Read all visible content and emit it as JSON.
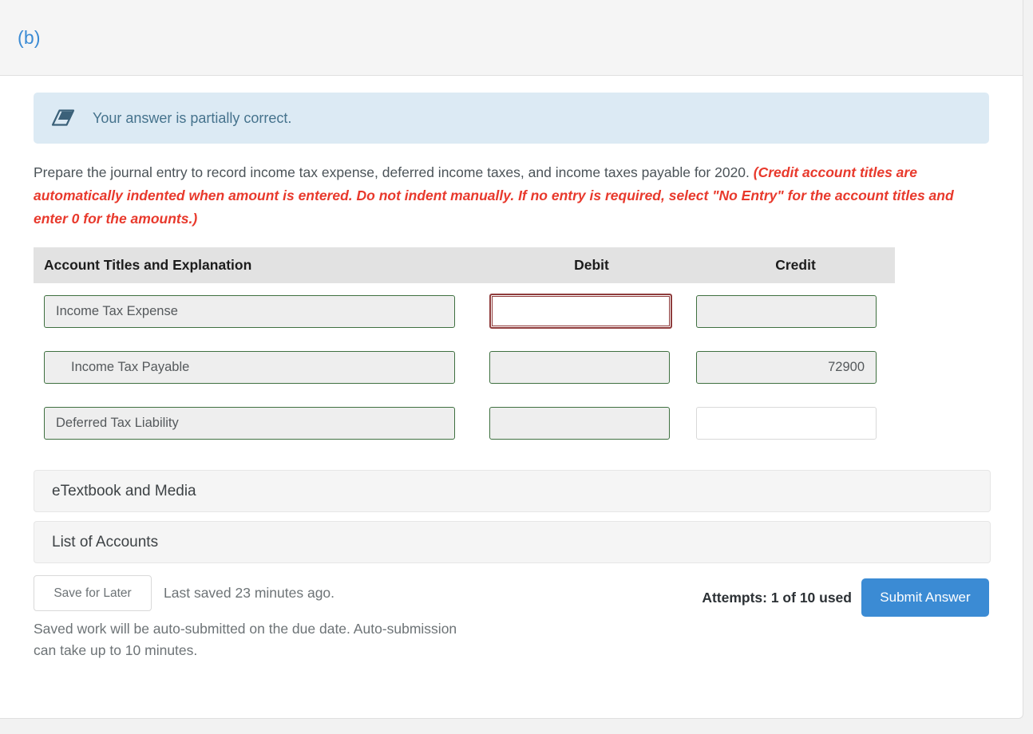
{
  "panel": {
    "part_label": "(b)"
  },
  "alert": {
    "icon": "eraser-icon",
    "message": "Your answer is partially correct.",
    "background_color": "#dceaf4",
    "text_color": "#46738d"
  },
  "instructions": {
    "main": "Prepare the journal entry to record income tax expense, deferred income taxes, and income taxes payable for 2020. ",
    "hint": "(Credit account titles are automatically indented when amount is entered. Do not indent manually. If no entry is required, select \"No Entry\" for the account titles and enter 0 for the amounts.)",
    "hint_color": "#e8392c"
  },
  "journal_table": {
    "headers": {
      "account": "Account Titles and Explanation",
      "debit": "Debit",
      "credit": "Credit"
    },
    "rows": [
      {
        "account": "Income Tax Expense",
        "account_state": "ok",
        "indent": false,
        "debit": "",
        "debit_state": "err",
        "credit": "",
        "credit_state": "ok"
      },
      {
        "account": "Income Tax Payable",
        "account_state": "ok",
        "indent": true,
        "debit": "",
        "debit_state": "ok",
        "credit": "72900",
        "credit_state": "ok"
      },
      {
        "account": "Deferred Tax Liability",
        "account_state": "ok",
        "indent": false,
        "debit": "",
        "debit_state": "ok",
        "credit": "",
        "credit_state": "plain"
      }
    ],
    "state_colors": {
      "ok_border": "#3f7040",
      "error_border": "#8f3c3c",
      "plain_border": "#d9d9d9",
      "header_background": "#e2e2e2"
    }
  },
  "bars": {
    "etextbook": "eTextbook and Media",
    "list_of_accounts": "List of Accounts"
  },
  "footer": {
    "save_button": "Save for Later",
    "last_saved": "Last saved 23 minutes ago.",
    "autosubmit_note": "Saved work will be auto-submitted on the due date. Auto-submission can take up to 10 minutes.",
    "attempts": "Attempts: 1 of 10 used",
    "submit_button": "Submit Answer",
    "submit_color": "#3b8bd4"
  }
}
